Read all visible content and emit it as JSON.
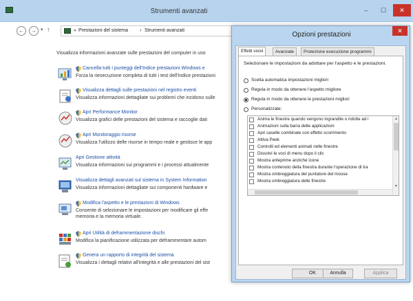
{
  "main_window": {
    "title": "Strumenti avanzati",
    "minimize": "–",
    "maximize": "☐",
    "close": "✕",
    "nav": {
      "back": "←",
      "forward": "→",
      "up": "↑",
      "recent": "▾"
    },
    "breadcrumb": [
      "Prestazioni del sistema",
      "Strumenti avanzati"
    ],
    "breadcrumb_prefix": "«",
    "breadcrumb_sep": "›",
    "intro": "Visualizza informazioni avanzate sulle prestazioni del computer in uso",
    "items": [
      {
        "link": "Cancella tutti i punteggi dell'Indice prestazioni Windows e",
        "desc": "Forza la riesecuzione completa di tutti i test dell'Indice prestazioni",
        "icon": "performance-index-icon",
        "shield": true
      },
      {
        "link": "Visualizza dettagli sulle prestazioni nel registro eventi",
        "desc": "Visualizza informazioni dettagliate sui problemi che incidono sulle",
        "icon": "event-log-icon",
        "shield": true
      },
      {
        "link": "Apri Performance Monitor",
        "desc": "Visualizza grafici delle prestazioni del sistema e raccoglie dati",
        "icon": "performance-monitor-icon",
        "shield": true
      },
      {
        "link": "Apri Monitoraggio risorse",
        "desc": "Visualizza l'utilizzo delle risorse in tempo reale e gestisce le app",
        "icon": "resource-monitor-icon",
        "shield": true
      },
      {
        "link": "Apri Gestione attività",
        "desc": "Visualizza informazioni sui programmi e i processi attualmente",
        "icon": "task-manager-icon",
        "shield": false
      },
      {
        "link": "Visualizza dettagli avanzati sul sistema in System Information",
        "desc": "Visualizza informazioni dettagliate sui componenti hardware e",
        "icon": "system-information-icon",
        "shield": false
      },
      {
        "link": "Modifica l'aspetto e le prestazioni di Windows",
        "desc": "Consente di selezionare le impostazioni per modificare gli effe",
        "desc2": "memoria e la memoria virtuale.",
        "icon": "visual-effects-icon",
        "shield": true
      },
      {
        "link": "Apri Utilità di deframmentazione dischi",
        "desc": "Modifica la pianificazione utilizzata per deframmentare autom",
        "icon": "defrag-icon",
        "shield": true
      },
      {
        "link": "Genera un rapporto di integrità del sistema",
        "desc": "Visualizza i dettagli relativi all'integrità e alle prestazioni del sist",
        "icon": "health-report-icon",
        "shield": true
      }
    ]
  },
  "dialog": {
    "title": "Opzioni prestazioni",
    "close": "✕",
    "tabs": [
      "Effetti visivi",
      "Avanzate",
      "Protezione esecuzione programmi"
    ],
    "instructions": "Selezionare le impostazioni da adottare per l'aspetto e le prestazioni.",
    "radios": [
      {
        "label": "Scelta automatica impostazioni migliori",
        "checked": false
      },
      {
        "label": "Regola in modo da ottenere l'aspetto migliore",
        "checked": false
      },
      {
        "label": "Regola in modo da ottenere le prestazioni migliori",
        "checked": true
      },
      {
        "label": "Personalizzate:",
        "checked": false
      }
    ],
    "effects": [
      "Anima le finestre quando vengono ingrandite o ridotte ad i",
      "Animazioni sulla barra delle applicazioni",
      "Apri caselle combinate con effetto scorrimento",
      "Attiva Peek",
      "Controlli ed elementi animati nelle finestre",
      "Dissolvi le voci di menu dopo il clic",
      "Mostra anteprime anziché icone",
      "Mostra contenuto della finestra durante l'operazione di tra",
      "Mostra ombreggiatura del puntatore del mouse",
      "Mostra ombreggiatura delle finestre"
    ],
    "buttons": {
      "ok": "OK",
      "cancel": "Annulla",
      "apply": "Applica"
    },
    "colors": {
      "titlebar": "#b9d5ef",
      "close": "#c8322a",
      "link": "#1c4fa4"
    }
  }
}
